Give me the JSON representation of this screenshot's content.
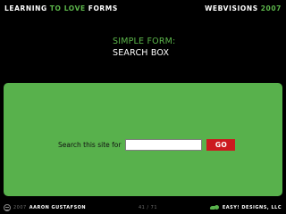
{
  "header": {
    "word_learning": "LEARNING",
    "word_to_love": "TO LOVE",
    "word_forms": "FORMS",
    "word_webvisions": "WEBVISIONS",
    "year": "2007"
  },
  "title": {
    "line1": "SIMPLE FORM:",
    "line2": "SEARCH BOX"
  },
  "search": {
    "label": "Search this site for",
    "value": "",
    "placeholder": "",
    "button_label": "GO"
  },
  "footer": {
    "copyright_year": "2007",
    "author": "AARON GUSTAFSON",
    "slide_number": "41 / 71",
    "company": "EASY! DESIGNS, LLC",
    "cc_icon": "creative-commons-icon",
    "logo_icon": "easy-designs-logo-icon"
  },
  "colors": {
    "background": "#000000",
    "accent_green": "#5cb64b",
    "stage_green": "#58b14c",
    "button_red": "#cc1a1f"
  }
}
